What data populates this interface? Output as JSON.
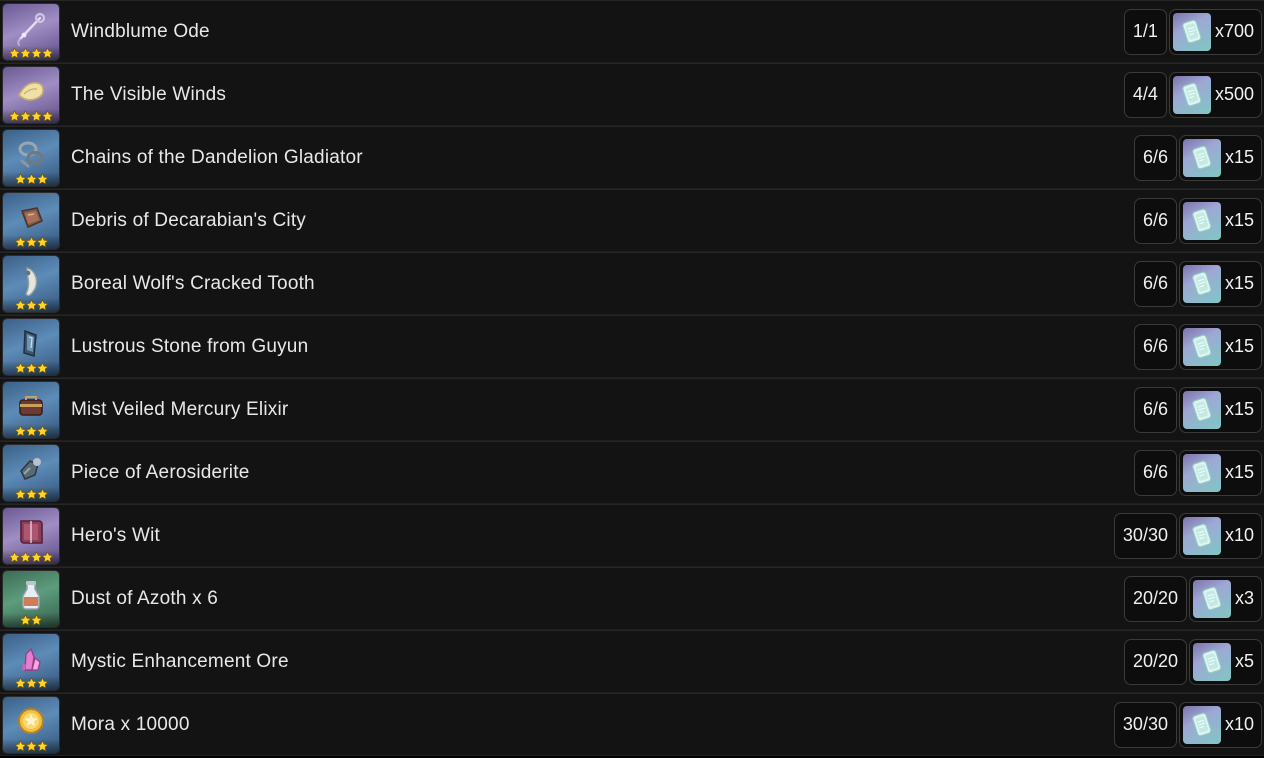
{
  "screen": {
    "name": "reward-list-panel",
    "background_color": "#000000",
    "row_background_color": "#131313",
    "text_color": "#e8e8e8"
  },
  "rarity_colors": {
    "five_star": "#c0a069",
    "four_star": "#9f8ec4",
    "three_star": "#5d8cb8",
    "two_star": "#5d9c7c",
    "star_glyph": "#ffd42a"
  },
  "reward_icon": {
    "name": "primogem-card-icon",
    "color": "#b9e6e2"
  },
  "rows": [
    {
      "name": "Windblume Ode",
      "rarity": 4,
      "thumb_icon": "bow-icon",
      "progress": "1/1",
      "reward_qty": "x700"
    },
    {
      "name": "The Visible Winds",
      "rarity": 4,
      "thumb_icon": "scroll-icon",
      "progress": "4/4",
      "reward_qty": "x500"
    },
    {
      "name": "Chains of the Dandelion Gladiator",
      "rarity": 3,
      "thumb_icon": "chains-icon",
      "progress": "6/6",
      "reward_qty": "x15"
    },
    {
      "name": "Debris of Decarabian's City",
      "rarity": 3,
      "thumb_icon": "debris-icon",
      "progress": "6/6",
      "reward_qty": "x15"
    },
    {
      "name": "Boreal Wolf's Cracked Tooth",
      "rarity": 3,
      "thumb_icon": "tooth-icon",
      "progress": "6/6",
      "reward_qty": "x15"
    },
    {
      "name": "Lustrous Stone from Guyun",
      "rarity": 3,
      "thumb_icon": "stone-icon",
      "progress": "6/6",
      "reward_qty": "x15"
    },
    {
      "name": "Mist Veiled Mercury Elixir",
      "rarity": 3,
      "thumb_icon": "elixir-icon",
      "progress": "6/6",
      "reward_qty": "x15"
    },
    {
      "name": "Piece of Aerosiderite",
      "rarity": 3,
      "thumb_icon": "aerosiderite-icon",
      "progress": "6/6",
      "reward_qty": "x15"
    },
    {
      "name": "Hero's Wit",
      "rarity": 4,
      "thumb_icon": "book-icon",
      "progress": "30/30",
      "reward_qty": "x10"
    },
    {
      "name": "Dust of Azoth x 6",
      "rarity": 2,
      "thumb_icon": "bottle-icon",
      "progress": "20/20",
      "reward_qty": "x3"
    },
    {
      "name": "Mystic Enhancement Ore",
      "rarity": 3,
      "thumb_icon": "crystal-icon",
      "progress": "20/20",
      "reward_qty": "x5"
    },
    {
      "name": "Mora x 10000",
      "rarity": 3,
      "thumb_icon": "coin-icon",
      "progress": "30/30",
      "reward_qty": "x10"
    }
  ]
}
